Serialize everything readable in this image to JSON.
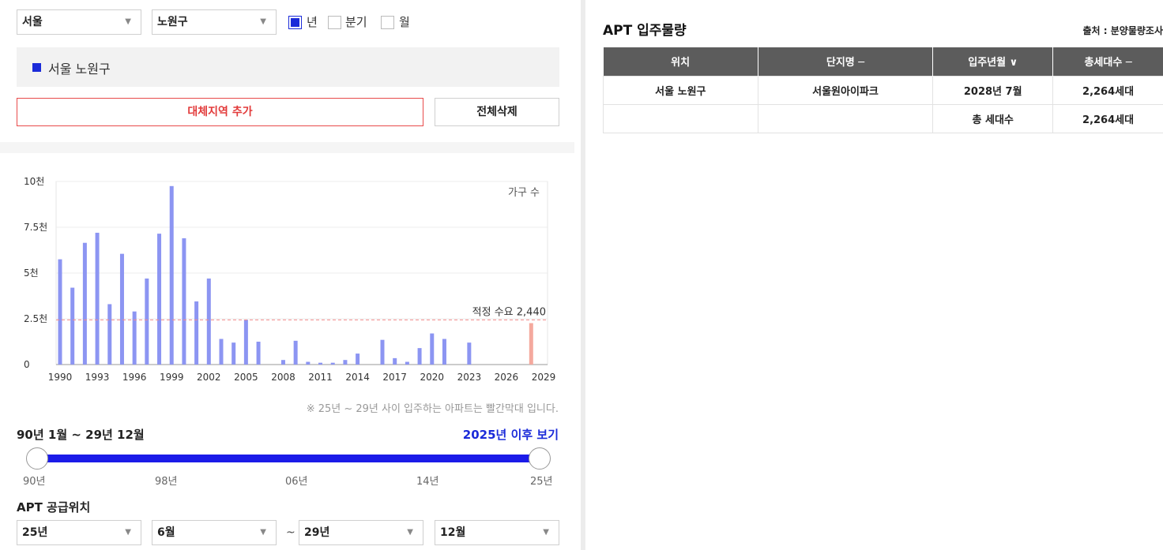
{
  "filters": {
    "city": "서울",
    "district": "노원구",
    "period_options": [
      {
        "label": "년",
        "checked": true
      },
      {
        "label": "분기",
        "checked": false
      },
      {
        "label": "월",
        "checked": false
      }
    ]
  },
  "selected_region": "서울 노원구",
  "buttons": {
    "add_region": "대체지역 추가",
    "clear_all": "전체삭제"
  },
  "chart_data": {
    "type": "bar",
    "series_label": "가구 수",
    "y_tick_labels": [
      "10천",
      "7.5천",
      "5천",
      "2.5천",
      "0"
    ],
    "x_tick_labels": [
      "1990",
      "1993",
      "1996",
      "1999",
      "2002",
      "2005",
      "2008",
      "2011",
      "2014",
      "2017",
      "2020",
      "2023",
      "2026",
      "2029"
    ],
    "ylim": [
      0,
      10000
    ],
    "xlim": [
      1990,
      2029
    ],
    "reference_line": {
      "label": "적정 수요 2,440",
      "value": 2440
    },
    "bar_color": "#8c95f2",
    "highlight_color": "#f4a99e",
    "bars": [
      {
        "year": 1990,
        "value": 5750
      },
      {
        "year": 1991,
        "value": 4200
      },
      {
        "year": 1992,
        "value": 6650
      },
      {
        "year": 1993,
        "value": 7200
      },
      {
        "year": 1994,
        "value": 3300
      },
      {
        "year": 1995,
        "value": 6050
      },
      {
        "year": 1996,
        "value": 2900
      },
      {
        "year": 1997,
        "value": 4700
      },
      {
        "year": 1998,
        "value": 7150
      },
      {
        "year": 1999,
        "value": 9750
      },
      {
        "year": 2000,
        "value": 6900
      },
      {
        "year": 2001,
        "value": 3450
      },
      {
        "year": 2002,
        "value": 4700
      },
      {
        "year": 2003,
        "value": 1400
      },
      {
        "year": 2004,
        "value": 1200
      },
      {
        "year": 2005,
        "value": 2450
      },
      {
        "year": 2006,
        "value": 1250
      },
      {
        "year": 2008,
        "value": 250
      },
      {
        "year": 2009,
        "value": 1300
      },
      {
        "year": 2010,
        "value": 150
      },
      {
        "year": 2011,
        "value": 100
      },
      {
        "year": 2012,
        "value": 100
      },
      {
        "year": 2013,
        "value": 250
      },
      {
        "year": 2014,
        "value": 600
      },
      {
        "year": 2016,
        "value": 1350
      },
      {
        "year": 2017,
        "value": 350
      },
      {
        "year": 2018,
        "value": 150
      },
      {
        "year": 2019,
        "value": 900
      },
      {
        "year": 2020,
        "value": 1700
      },
      {
        "year": 2021,
        "value": 1400
      },
      {
        "year": 2023,
        "value": 1200
      },
      {
        "year": 2028,
        "value": 2264,
        "highlight": true
      }
    ]
  },
  "chart_note": "※ 25년 ~ 29년 사이 입주하는 아파트는 빨간막대 입니다.",
  "range": {
    "title": "90년 1월 ~ 29년 12월",
    "link": "2025년 이후 보기",
    "ticks": [
      "90년",
      "98년",
      "06년",
      "14년",
      "25년"
    ]
  },
  "supply_position": {
    "title": "APT 공급위치",
    "start_year": "25년",
    "start_month": "6월",
    "separator": "~",
    "end_year": "29년",
    "end_month": "12월"
  },
  "right_panel": {
    "title": "APT 입주물량",
    "source": "출처 : 분양물량조사",
    "columns": [
      "위치",
      "단지명 ─",
      "입주년월 ∨",
      "총세대수 ─"
    ],
    "rows": [
      [
        "서울 노원구",
        "서울원아이파크",
        "2028년 7월",
        "2,264세대"
      ],
      [
        "",
        "",
        "총 세대수",
        "2,264세대"
      ]
    ]
  }
}
